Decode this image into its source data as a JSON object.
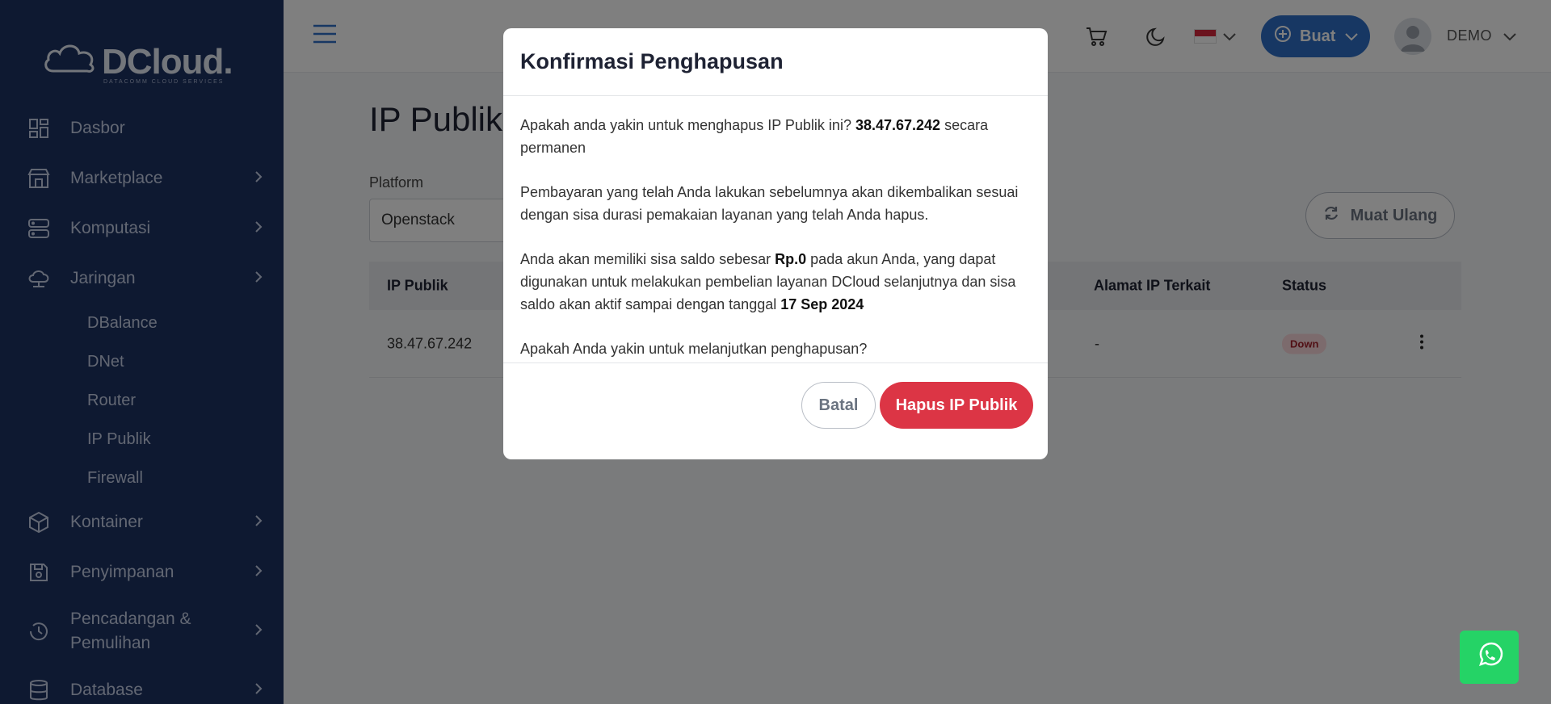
{
  "brand": {
    "name": "DCloud.",
    "tagline": "DATACOMM CLOUD SERVICES"
  },
  "sidebar": {
    "items": [
      {
        "label": "Dasbor",
        "icon": "dashboard-icon"
      },
      {
        "label": "Marketplace",
        "icon": "store-icon"
      },
      {
        "label": "Komputasi",
        "icon": "server-icon"
      },
      {
        "label": "Jaringan",
        "icon": "cloud-network-icon"
      }
    ],
    "sub_items": [
      "DBalance",
      "DNet",
      "Router",
      "IP Publik",
      "Firewall"
    ],
    "items_after": [
      {
        "label": "Kontainer",
        "icon": "box-icon"
      },
      {
        "label": "Penyimpanan",
        "icon": "save-icon"
      },
      {
        "label": "Pencadangan & Pemulihan",
        "line1": "Pencadangan &",
        "line2": "Pemulihan",
        "icon": "history-icon"
      },
      {
        "label": "Database",
        "icon": "database-icon"
      }
    ]
  },
  "topbar": {
    "create_label": "Buat",
    "user_name": "DEMO",
    "language": "Indonesia"
  },
  "page": {
    "title": "IP Publik",
    "platform_label": "Platform",
    "platform_value": "Openstack",
    "reload_label": "Muat Ulang"
  },
  "table": {
    "headers": {
      "ip": "IP Publik",
      "linked": "Alamat IP Terkait",
      "status": "Status"
    },
    "rows": [
      {
        "ip": "38.47.67.242",
        "linked": "-",
        "status": "Down"
      }
    ]
  },
  "modal": {
    "title": "Konfirmasi Penghapusan",
    "p1_pre": "Apakah anda yakin untuk menghapus IP Publik ini? ",
    "p1_ip": "38.47.67.242",
    "p1_post": " secara permanen",
    "p2": "Pembayaran yang telah Anda lakukan sebelumnya akan dikembalikan sesuai dengan sisa durasi pemakaian layanan yang telah Anda hapus.",
    "p3_pre": "Anda akan memiliki sisa saldo sebesar ",
    "p3_amount": "Rp.0",
    "p3_mid": " pada akun Anda, yang dapat digunakan untuk melakukan pembelian layanan DCloud selanjutnya dan sisa saldo akan aktif sampai dengan tanggal ",
    "p3_date": "17 Sep 2024",
    "p4": "Apakah Anda yakin untuk melanjutkan penghapusan?",
    "cancel_label": "Batal",
    "confirm_label": "Hapus IP Publik"
  },
  "colors": {
    "sidebar_bg": "#1d3262",
    "primary": "#2f6fc6",
    "danger": "#dc3545",
    "whatsapp": "#25d366"
  }
}
